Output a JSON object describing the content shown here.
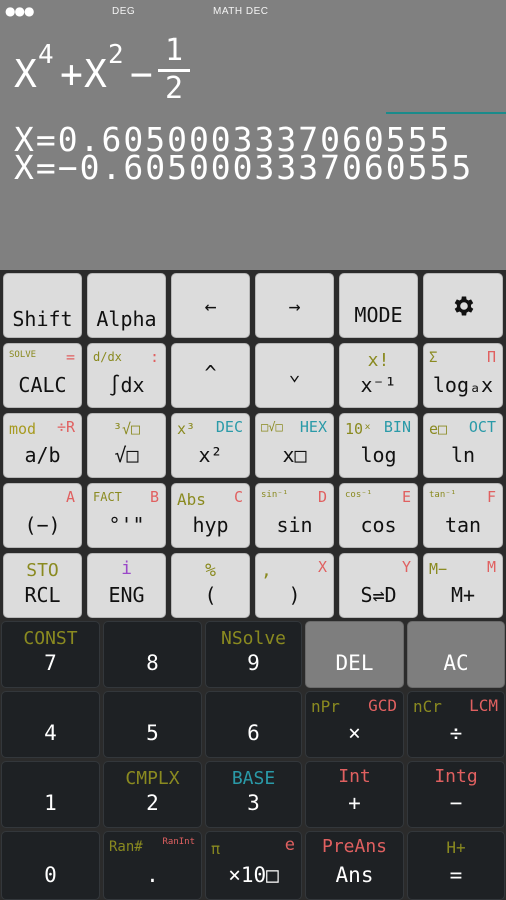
{
  "status": {
    "deg": "DEG",
    "mode": "MATH DEC",
    "menu_icon": "dots-menu-icon"
  },
  "display": {
    "expr_x": "X",
    "expr_p4": "4",
    "expr_plus": "+",
    "expr_x2": "X",
    "expr_p2": "2",
    "expr_minus": "−",
    "frac_num": "1",
    "frac_den": "2",
    "result1": "X=0.6050003337060555",
    "result2": "X=−0.6050003337060555"
  },
  "keys": {
    "shift": "Shift",
    "alpha": "Alpha",
    "left": "←",
    "right": "→",
    "mode": "MODE",
    "settings_icon": "gear-icon",
    "calc": "CALC",
    "calc_tl": "SOLVE",
    "calc_tr": "=",
    "intdx": "∫dx",
    "intdx_tl": "d/dx",
    "intdx_tr": ":",
    "up": "^",
    "down": "⌄",
    "xinv": "x⁻¹",
    "xinv_t": "x!",
    "logax": "logₐx",
    "logax_tl": "Σ",
    "logax_tr": "Π",
    "ab": "a/b",
    "ab_tl": "mod",
    "ab_tr": "÷R",
    "sqrt": "√□",
    "sqrt_t": "³√□",
    "x2": "x²",
    "x2_tl": "x³",
    "x2_tr": "DEC",
    "xpow": "x□",
    "xpow_tl": "□√□",
    "xpow_tr": "HEX",
    "log": "log",
    "log_tl": "10ˣ",
    "log_tr": "BIN",
    "ln": "ln",
    "ln_tl": "e□",
    "ln_tr": "OCT",
    "neg": "(−)",
    "neg_tr": "A",
    "deg": "°'\"",
    "deg_tl": "FACT",
    "deg_tr": "B",
    "hyp": "hyp",
    "hyp_tl": "Abs",
    "hyp_tr": "C",
    "sin": "sin",
    "sin_tl": "sin⁻¹",
    "sin_tr": "D",
    "cos": "cos",
    "cos_tl": "cos⁻¹",
    "cos_tr": "E",
    "tan": "tan",
    "tan_tl": "tan⁻¹",
    "tan_tr": "F",
    "rcl": "RCL",
    "rcl_t": "STO",
    "eng": "ENG",
    "eng_t": "i",
    "lparen": "(",
    "lparen_t": "%",
    "rparen": ")",
    "rparen_tl": ",",
    "rparen_tr": "X",
    "sd": "S⇌D",
    "sd_tr": "Y",
    "mplus": "M+",
    "mplus_tl": "M−",
    "mplus_tr": "M",
    "n7": "7",
    "n7_t": "CONST",
    "n8": "8",
    "n9": "9",
    "n9_t": "NSolve",
    "del": "DEL",
    "ac": "AC",
    "n4": "4",
    "n5": "5",
    "n6": "6",
    "mul": "×",
    "mul_tl": "nPr",
    "mul_tr": "GCD",
    "div": "÷",
    "div_tl": "nCr",
    "div_tr": "LCM",
    "n1": "1",
    "n2": "2",
    "n2_t": "CMPLX",
    "n3": "3",
    "n3_t": "BASE",
    "plus": "+",
    "plus_t": "Int",
    "minus": "−",
    "minus_t": "Intg",
    "n0": "0",
    "dot": ".",
    "dot_tl": "Ran#",
    "dot_tr": "RanInt",
    "x10": "×10□",
    "x10_tl": "π",
    "x10_tr": "e",
    "ans": "Ans",
    "ans_t": "PreAns",
    "eq": "=",
    "eq_t": "H+"
  },
  "colors": {
    "display_bg": "#808080",
    "light_key": "#dcdcdc",
    "dark_key": "#1e2124",
    "red_label": "#e06060",
    "olive_label": "#8a8a20",
    "teal_label": "#2a9aa8",
    "purple_label": "#9a48c8"
  }
}
